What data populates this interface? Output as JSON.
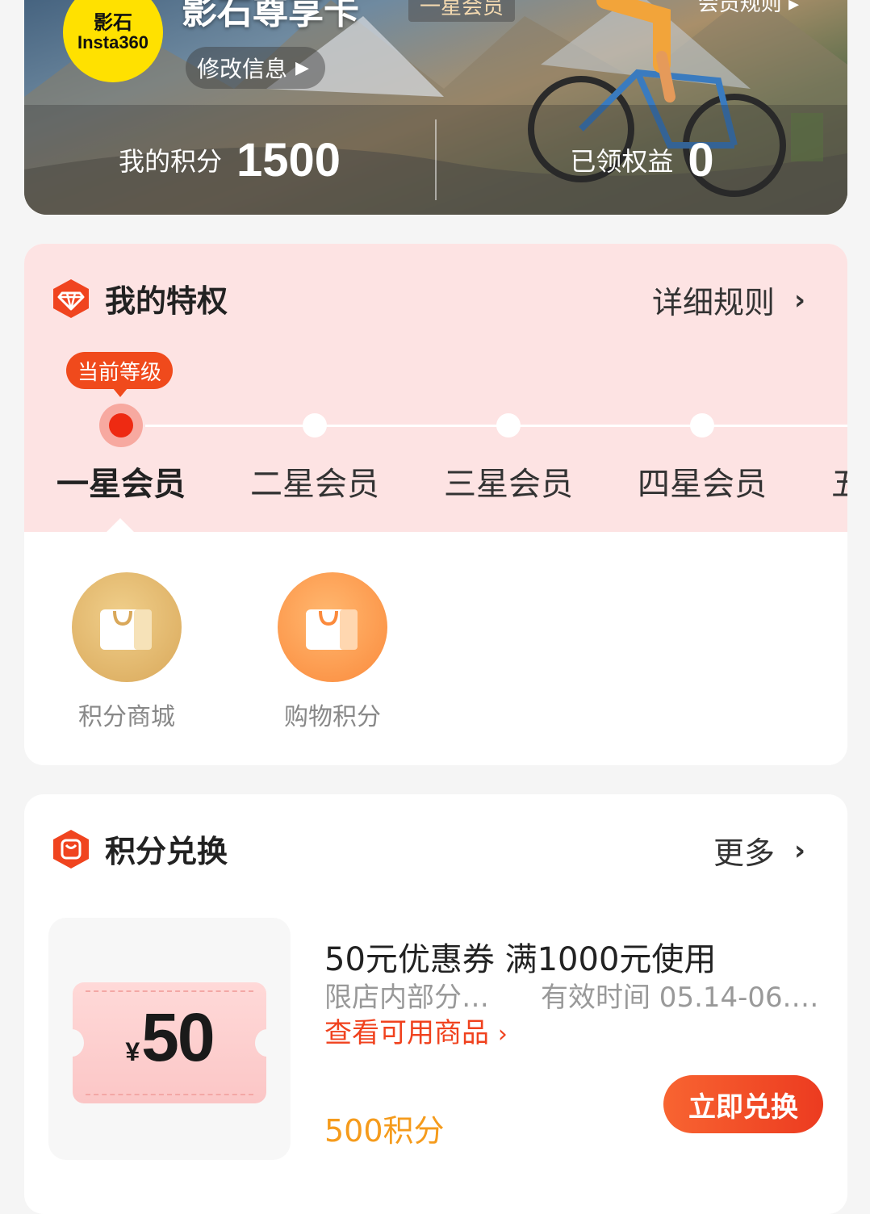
{
  "member_card": {
    "logo_line1": "影石",
    "logo_line2": "Insta360",
    "name": "影石尊享卡",
    "level_tag": "一星会员",
    "rules_link": "会员规则",
    "edit_info": "修改信息",
    "points_label": "我的积分",
    "points_value": "1500",
    "benefits_label": "已领权益",
    "benefits_value": "0"
  },
  "privileges": {
    "title": "我的特权",
    "more_label": "详细规则",
    "current_badge": "当前等级",
    "levels": [
      "一星会员",
      "二星会员",
      "三星会员",
      "四星会员",
      "五星会员"
    ],
    "current_level_index": 0,
    "features": [
      {
        "label": "积分商城",
        "icon": "shopping-bag-icon"
      },
      {
        "label": "购物积分",
        "icon": "shopping-bag-icon"
      }
    ]
  },
  "exchange": {
    "title": "积分兑换",
    "more_label": "更多",
    "item": {
      "coupon_symbol": "¥",
      "coupon_amount": "50",
      "title": "50元优惠券 满1000元使用",
      "scope": "限店内部分…",
      "validity": "有效时间 05.14-06.…",
      "link": "查看可用商品",
      "points": "500积分",
      "button": "立即兑换"
    }
  },
  "colors": {
    "accent_red": "#f0421e",
    "points_orange": "#f59b1c",
    "privilege_bg": "#fde3e3",
    "logo_yellow": "#ffe100"
  }
}
